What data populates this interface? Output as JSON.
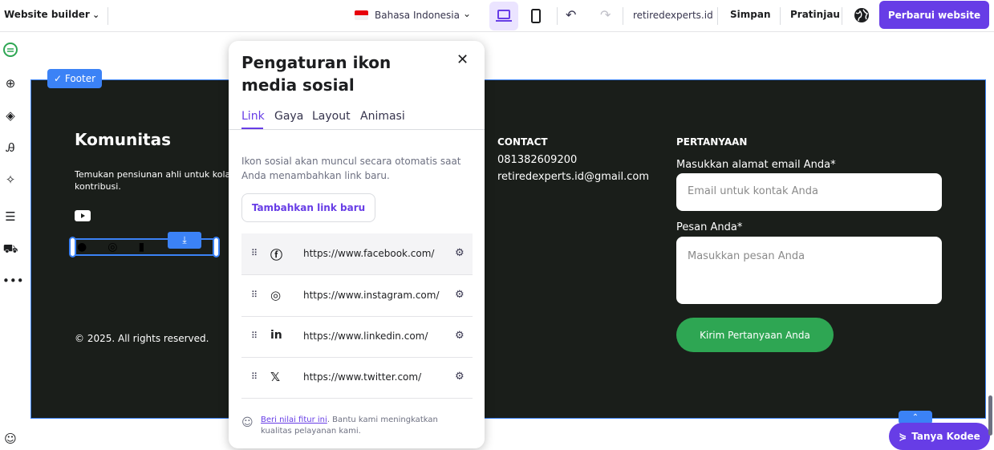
{
  "topbar": {
    "brand": "Website builder",
    "language": "Bahasa Indonesia",
    "domain": "retiredexperts.id",
    "save": "Simpan",
    "preview": "Pratinjau",
    "update": "Perbarui website"
  },
  "sidebar": {
    "icons": [
      "logo-icon",
      "add-icon",
      "layers-icon",
      "styles-icon",
      "ai-icon",
      "pages-icon",
      "store-icon",
      "more-icon",
      "help-icon"
    ]
  },
  "footer": {
    "tag": "✓ Footer",
    "community_title": "Komunitas",
    "community_text_1": "Temukan pensiunan ahli untuk kolab",
    "community_text_2": "kontribusi.",
    "copyright": "© 2025. All rights reserved.",
    "contact_title": "CONTACT",
    "phone": "081382609200",
    "email": "retiredexperts.id@gmail.com",
    "questions_title": "PERTANYAAN",
    "email_label": "Masukkan alamat email Anda*",
    "email_placeholder": "Email untuk kontak Anda",
    "message_label": "Pesan Anda*",
    "message_placeholder": "Masukkan pesan Anda",
    "submit": "Kirim Pertanyaan Anda"
  },
  "modal": {
    "title": "Pengaturan ikon media sosial",
    "tabs": [
      "Link",
      "Gaya",
      "Layout",
      "Animasi"
    ],
    "active_tab": "Link",
    "hint": "Ikon sosial akan muncul secara otomatis saat Anda menambahkan link baru.",
    "add_button": "Tambahkan link baru",
    "links": [
      {
        "icon": "facebook-icon",
        "url": "https://www.facebook.com/"
      },
      {
        "icon": "instagram-icon",
        "url": "https://www.instagram.com/"
      },
      {
        "icon": "linkedin-icon",
        "url": "https://www.linkedin.com/"
      },
      {
        "icon": "x-icon",
        "url": "https://www.twitter.com/"
      }
    ],
    "feedback_link": "Beri nilai fitur ini",
    "feedback_text": ". Bantu kami meningkatkan kualitas pelayanan kami."
  },
  "assistant": {
    "label": "Tanya Kodee"
  },
  "colors": {
    "primary": "#673de6",
    "selection": "#3b82f6",
    "footer_bg": "#1a1e1a",
    "submit_green": "#2ea653"
  }
}
